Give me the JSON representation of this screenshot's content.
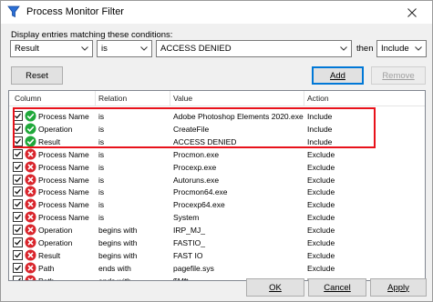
{
  "window": {
    "title": "Process Monitor Filter"
  },
  "conditions": {
    "label": "Display entries matching these conditions:",
    "column": "Result",
    "relation": "is",
    "value": "ACCESS DENIED",
    "then_label": "then",
    "action": "Include"
  },
  "buttons": {
    "reset": "Reset",
    "add": "Add",
    "remove": "Remove",
    "ok": "OK",
    "cancel": "Cancel",
    "apply": "Apply"
  },
  "table": {
    "headers": [
      "Column",
      "Relation",
      "Value",
      "Action"
    ],
    "rows": [
      {
        "column": "Process Name",
        "relation": "is",
        "value": "Adobe Photoshop Elements 2020.exe",
        "action": "Include",
        "status": "include"
      },
      {
        "column": "Operation",
        "relation": "is",
        "value": "CreateFile",
        "action": "Include",
        "status": "include"
      },
      {
        "column": "Result",
        "relation": "is",
        "value": "ACCESS DENIED",
        "action": "Include",
        "status": "include"
      },
      {
        "column": "Process Name",
        "relation": "is",
        "value": "Procmon.exe",
        "action": "Exclude",
        "status": "exclude"
      },
      {
        "column": "Process Name",
        "relation": "is",
        "value": "Procexp.exe",
        "action": "Exclude",
        "status": "exclude"
      },
      {
        "column": "Process Name",
        "relation": "is",
        "value": "Autoruns.exe",
        "action": "Exclude",
        "status": "exclude"
      },
      {
        "column": "Process Name",
        "relation": "is",
        "value": "Procmon64.exe",
        "action": "Exclude",
        "status": "exclude"
      },
      {
        "column": "Process Name",
        "relation": "is",
        "value": "Procexp64.exe",
        "action": "Exclude",
        "status": "exclude"
      },
      {
        "column": "Process Name",
        "relation": "is",
        "value": "System",
        "action": "Exclude",
        "status": "exclude"
      },
      {
        "column": "Operation",
        "relation": "begins with",
        "value": "IRP_MJ_",
        "action": "Exclude",
        "status": "exclude"
      },
      {
        "column": "Operation",
        "relation": "begins with",
        "value": "FASTIO_",
        "action": "Exclude",
        "status": "exclude"
      },
      {
        "column": "Result",
        "relation": "begins with",
        "value": "FAST IO",
        "action": "Exclude",
        "status": "exclude"
      },
      {
        "column": "Path",
        "relation": "ends with",
        "value": "pagefile.sys",
        "action": "Exclude",
        "status": "exclude"
      },
      {
        "column": "Path",
        "relation": "ends with",
        "value": "$Mft",
        "action": "Exclude",
        "status": "exclude"
      }
    ]
  },
  "colors": {
    "include": "#1fa83a",
    "exclude": "#d9252c",
    "highlight": "#e8121b",
    "accent": "#0078d7"
  },
  "icons": {
    "app": "process-monitor-filter-icon",
    "close": "close-icon",
    "dropdown": "chevron-down-icon",
    "include": "check-circle-icon",
    "exclude": "x-circle-icon"
  }
}
